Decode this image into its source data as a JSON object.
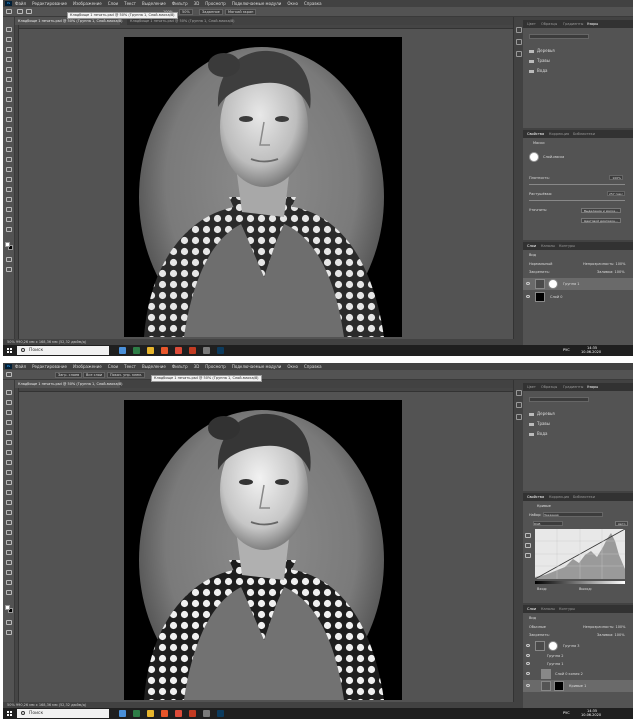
{
  "menu": [
    "Файл",
    "Редактирование",
    "Изображение",
    "Слои",
    "Текст",
    "Выделение",
    "Фильтр",
    "3D",
    "Просмотр",
    "Подключаемые модули",
    "Окно",
    "Справка"
  ],
  "app_logo": "Ps",
  "screen1": {
    "tooltip": "Кладбище 1 печать.psd @ 50% (Группа 1, Слой-маска/8)",
    "tabs": [
      "Кладбище 1 печать.psd @ 50% (Группа 1, Слой-маска/8)",
      "Кладбище 1 печать.psd @ 50% (Группа 1, Слой-маска/8)"
    ],
    "options": {
      "opacity_label": "100%",
      "chip1": "50%",
      "chip2": "Заданное",
      "chip3": "Мягкий экран"
    },
    "status": "50%     990,26 мм x 168,36 мм (52,32 дюйм/д)",
    "layers_top_tabs": [
      "Цвет",
      "Образцы",
      "Градиенты",
      "Узоры"
    ],
    "folders": [
      "Деревья",
      "Травы",
      "Вода"
    ],
    "properties_tabs": [
      "Свойства",
      "Коррекция",
      "Библиотеки"
    ],
    "properties_type": "Маски",
    "mask_label": "Слой-маска",
    "density_label": "Плотность:",
    "density_value": "100%",
    "feather_label": "Растушёвка:",
    "feather_value": "257 пикс",
    "refine_label": "Уточнить:",
    "btn_select_mask": "Выделение и маска...",
    "btn_color_range": "Цветовой диапазон...",
    "layers_tabs": [
      "Слои",
      "Каналы",
      "Контуры"
    ],
    "kind_label": "Вид",
    "blend_mode": "Нормальный",
    "opacity_text": "Непрозрачность: 100%",
    "lock_label": "Закрепить:",
    "fill_text": "Заливка: 100%",
    "layers": [
      {
        "name": "Группа 1"
      },
      {
        "name": "Слой 0"
      }
    ]
  },
  "screen2": {
    "tooltip": "Кладбище 1 печать.psd @ 50% (Группа 1, Слой-маска/8)",
    "tabs": [
      "Кладбище 1 печать.psd @ 50% (Группа 1, Слой-маска/8)"
    ],
    "options": {
      "chip1": "Загр. слоев",
      "chip2": "Все слои",
      "chip3": "Показ. упр. элем."
    },
    "status": "50%     990,26 мм x 168,36 мм (52,32 дюйм/д)",
    "layers_top_tabs": [
      "Цвет",
      "Образцы",
      "Градиенты",
      "Узоры"
    ],
    "folders": [
      "Деревья",
      "Травы",
      "Вода"
    ],
    "properties_tabs": [
      "Свойства",
      "Коррекция",
      "Библиотеки"
    ],
    "properties_type": "Кривые",
    "preset_label": "Набор:",
    "preset_value": "Заказная",
    "channel_value": "RGB",
    "auto_label": "Авто",
    "in_label": "Вход:",
    "out_label": "Выход:",
    "layers_tabs": [
      "Слои",
      "Каналы",
      "Контуры"
    ],
    "kind_label": "Вид",
    "blend_mode": "Обычные",
    "opacity_text": "Непрозрачность: 100%",
    "lock_label": "Закрепить:",
    "fill_text": "Заливка: 100%",
    "layers": [
      {
        "name": "Группа 3"
      },
      {
        "name": "Группа 2"
      },
      {
        "name": "Группа 1"
      },
      {
        "name": "Слой 0 копия 2"
      },
      {
        "name": "Кривые 1"
      }
    ]
  },
  "taskbar": {
    "search_placeholder": "Поиск",
    "lang": "РУС",
    "time1": "14:35",
    "date1": "10.06.2020",
    "time2": "14:35",
    "date2": "10.06.2020"
  }
}
